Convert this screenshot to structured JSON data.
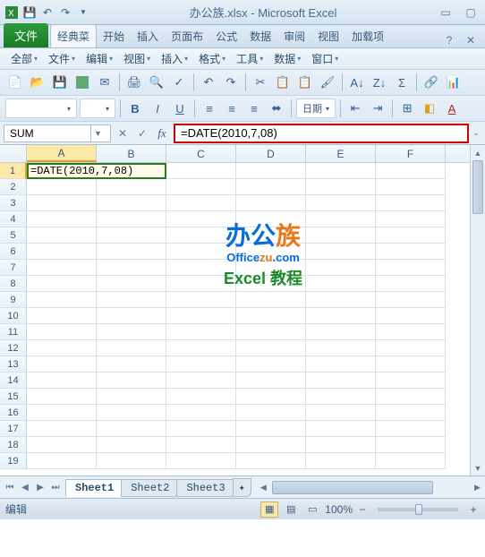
{
  "title": "办公族.xlsx - Microsoft Excel",
  "ribbon": {
    "file": "文件",
    "tabs": [
      "经典菜",
      "开始",
      "插入",
      "页面布",
      "公式",
      "数据",
      "审阅",
      "视图",
      "加载项"
    ],
    "active_tab_index": 0
  },
  "classic_menu": {
    "items": [
      "全部",
      "文件",
      "编辑",
      "视图",
      "插入",
      "格式",
      "工具",
      "数据",
      "窗口"
    ]
  },
  "toolbar2": {
    "date_label": "日期"
  },
  "formula_bar": {
    "name_box": "SUM",
    "formula": "=DATE(2010,7,08)"
  },
  "grid": {
    "columns": [
      "A",
      "B",
      "C",
      "D",
      "E",
      "F"
    ],
    "active_col_index": 0,
    "rows": 19,
    "active_row": 1,
    "cell_a1": "=DATE(2010,7,08)"
  },
  "watermark": {
    "line1a": "办公",
    "line1b": "族",
    "line2a": "Office",
    "line2b": "zu",
    "line2c": ".com",
    "line3": "Excel 教程"
  },
  "sheet_tabs": {
    "tabs": [
      "Sheet1",
      "Sheet2",
      "Sheet3"
    ],
    "active_index": 0
  },
  "statusbar": {
    "mode": "编辑",
    "zoom": "100%"
  }
}
